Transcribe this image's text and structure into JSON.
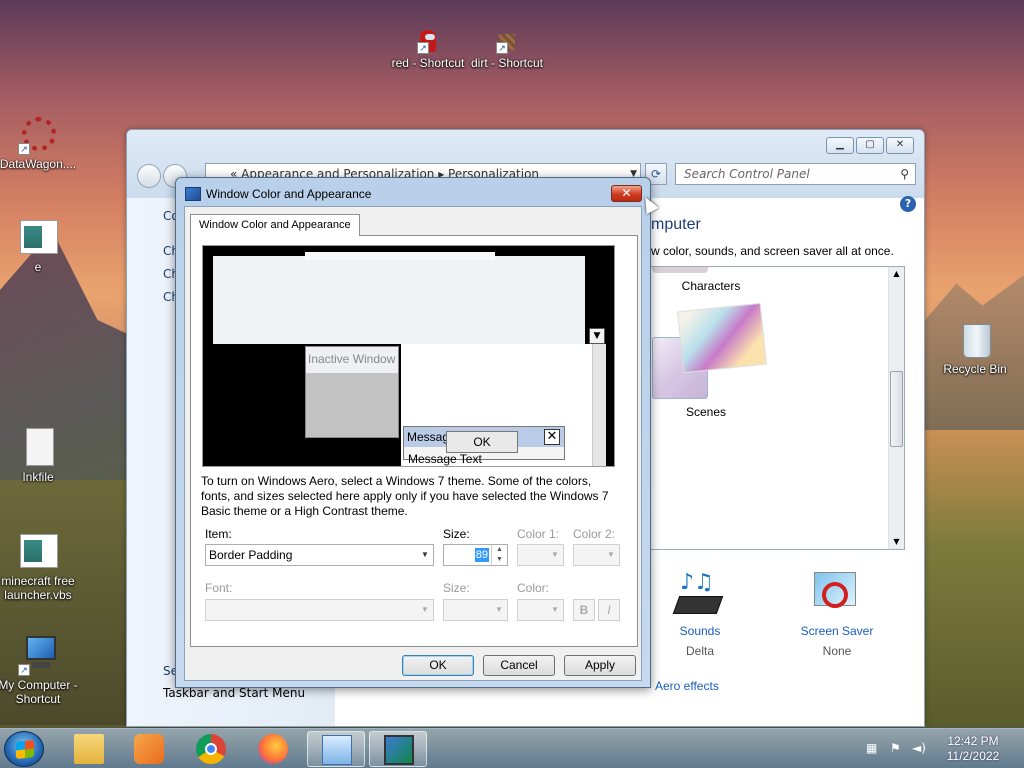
{
  "desktop": {
    "icons": [
      {
        "label": "red - Shortcut",
        "name": "red-shortcut"
      },
      {
        "label": "dirt - Shortcut",
        "name": "dirt-shortcut"
      },
      {
        "label": "DataWagon....",
        "name": "datawagon-shortcut"
      },
      {
        "label": "e",
        "name": "e-file"
      },
      {
        "label": "Inkfile",
        "name": "inkfile"
      },
      {
        "label": "minecraft free launcher.vbs",
        "name": "minecraft-launcher"
      },
      {
        "label": "My Computer - Shortcut",
        "name": "my-computer-shortcut"
      },
      {
        "label": "Recycle Bin",
        "name": "recycle-bin"
      }
    ]
  },
  "control_panel": {
    "address": "« Appearance and Personalization ▸ Personalization",
    "search_placeholder": "Search Control Panel",
    "heading_fragment": "mputer",
    "subtitle_fragment": "w color, sounds, and screen saver all at once.",
    "left_fragments": [
      "Co",
      "Ch",
      "Ch",
      "Ch",
      "Se"
    ],
    "left_bottom": "Taskbar and Start Menu",
    "themes": [
      {
        "label": "Characters"
      },
      {
        "label": "Scenes"
      }
    ],
    "sounds": {
      "label": "Sounds",
      "value": "Delta"
    },
    "screen_saver": {
      "label": "Screen Saver",
      "value": "None"
    },
    "aero_link": "Aero effects"
  },
  "dialog": {
    "title": "Window Color and Appearance",
    "tab": "Window Color and Appearance",
    "preview": {
      "inactive_title": "Inactive Window",
      "message_title": "Messag",
      "ok": "OK",
      "message_text": "Message Text"
    },
    "description": "To turn on Windows Aero, select a Windows 7 theme.  Some of the colors, fonts, and sizes selected here apply only if you have selected the Windows 7 Basic theme or a High Contrast theme.",
    "labels": {
      "item": "Item:",
      "size": "Size:",
      "color1": "Color 1:",
      "color2": "Color 2:",
      "font": "Font:",
      "font_size": "Size:",
      "color": "Color:"
    },
    "item_value": "Border Padding",
    "size_value": "89",
    "bold": "B",
    "italic": "I",
    "buttons": {
      "ok": "OK",
      "cancel": "Cancel",
      "apply": "Apply"
    }
  },
  "taskbar": {
    "time": "12:42 PM",
    "date": "11/2/2022"
  }
}
